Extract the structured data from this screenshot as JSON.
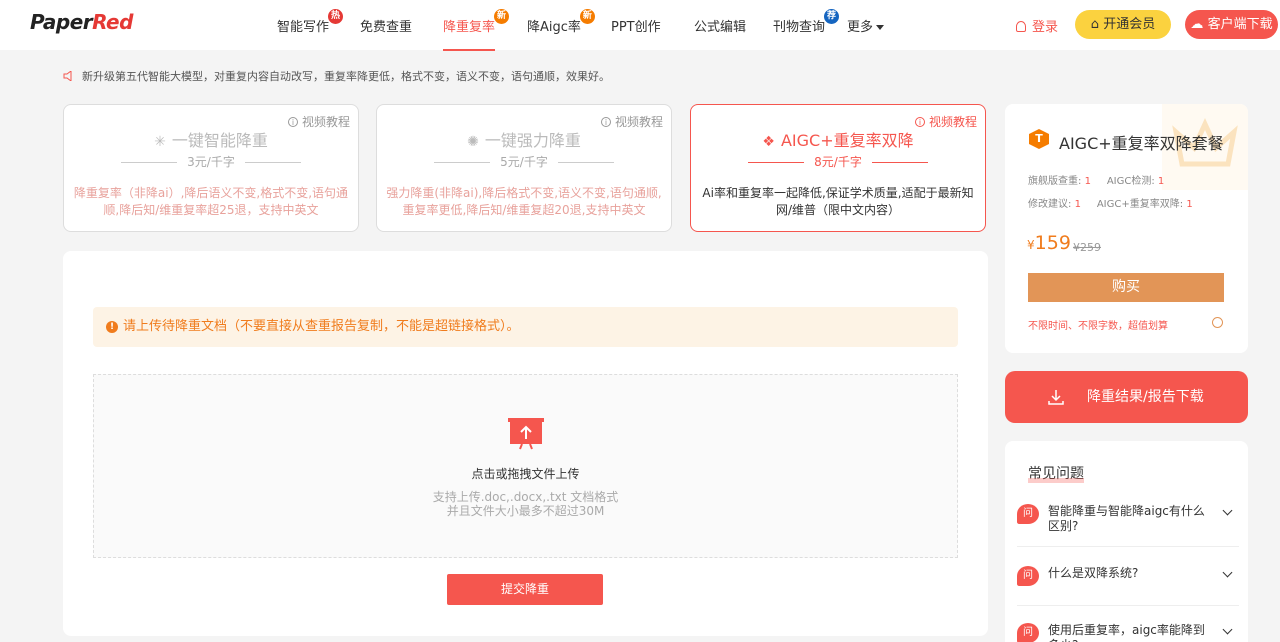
{
  "brand": {
    "logo_a": "Paper",
    "logo_b": "Red"
  },
  "nav": [
    {
      "label": "智能写作",
      "badge": "热"
    },
    {
      "label": "免费查重",
      "badge": ""
    },
    {
      "label": "降重复率",
      "badge": "新"
    },
    {
      "label": "降Aigc率",
      "badge": "新"
    },
    {
      "label": "PPT创作",
      "badge": ""
    },
    {
      "label": "公式编辑",
      "badge": ""
    },
    {
      "label": "刊物查询",
      "badge": "荐"
    },
    {
      "label": "更多",
      "badge": ""
    }
  ],
  "header": {
    "login": "登录",
    "vip": "开通会员",
    "client": "客户端下载"
  },
  "notice": "新升级第五代智能大模型，对重复内容自动改写，重复率降更低，格式不变，语义不变，语句通顺，效果好。",
  "modes": [
    {
      "tutorial": "视频教程",
      "icon": "✳",
      "title": "一键智能降重",
      "price": "3元/千字",
      "desc": "降重复率（非降ai）,降后语义不变,格式不变,语句通顺,降后知/维重复率超25退，支持中英文"
    },
    {
      "tutorial": "视频教程",
      "icon": "✺",
      "title": "一键强力降重",
      "price": "5元/千字",
      "desc": "强力降重(非降ai),降后格式不变,语义不变,语句通顺,重复率更低,降后知/维重复超20退,支持中英文"
    },
    {
      "tutorial": "视频教程",
      "icon": "❖",
      "title": "AIGC+重复率双降",
      "price": "8元/千字",
      "desc": "Ai率和重复率一起降低,保证学术质量,适配于最新知网/维普（限中文内容）"
    }
  ],
  "upload": {
    "alert": "请上传待降重文档（不要直接从查重报告复制，不能是超链接格式）。",
    "main": "点击或拖拽文件上传",
    "sub1": "支持上传.doc,.docx,.txt 文档格式",
    "sub2": "并且文件大小最多不超过30M",
    "submit": "提交降重"
  },
  "package": {
    "title": "AIGC+重复率双降套餐",
    "m1_label": "旗舰版查重:",
    "m1_val": "1",
    "m2_label": "AIGC检测:",
    "m2_val": "1",
    "m3_label": "修改建议:",
    "m3_val": "1",
    "m4_label": "AIGC+重复率双降:",
    "m4_val": "1",
    "currency": "¥",
    "price": "159",
    "old_price": "¥259",
    "buy": "购买",
    "perk": "不限时间、不限字数，超值划算"
  },
  "download": "降重结果/报告下载",
  "faq": {
    "title": "常见问题",
    "q_icon": "问",
    "items": [
      "智能降重与智能降aigc有什么区别?",
      "什么是双降系统?",
      "使用后重复率，aigc率能降到多少?"
    ]
  },
  "colors": {
    "accent": "#f5564e",
    "orange": "#f07c1d",
    "vip": "#fbd23f",
    "buy": "#e29557"
  }
}
